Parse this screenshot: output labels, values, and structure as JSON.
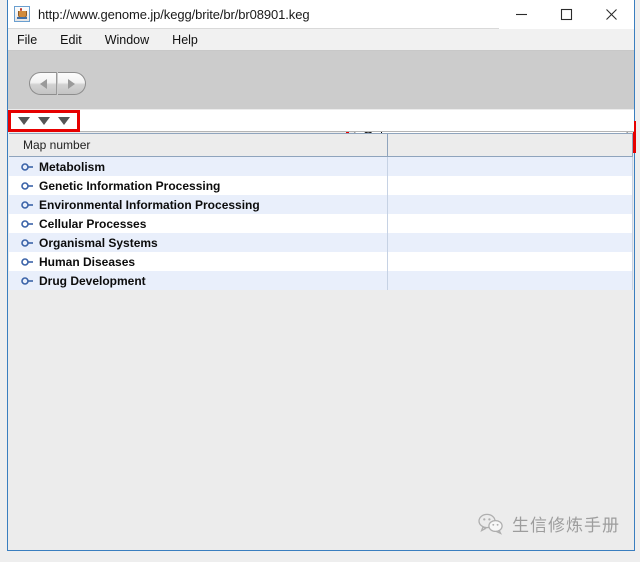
{
  "window": {
    "title": "http://www.genome.jp/kegg/brite/br/br08901.keg",
    "app_icon": "java-icon",
    "controls": {
      "minimize": "minimize-icon",
      "maximize": "maximize-icon",
      "close": "close-icon"
    }
  },
  "menubar": {
    "items": [
      {
        "label": "File"
      },
      {
        "label": "Edit"
      },
      {
        "label": "Window"
      },
      {
        "label": "Help"
      }
    ]
  },
  "toolbar": {
    "back_icon": "arrow-left-icon",
    "forward_icon": "arrow-right-icon"
  },
  "search": {
    "icon": "search-icon",
    "value": "",
    "placeholder": ""
  },
  "filter_bar": {
    "triangles": [
      {
        "icon": "triangle-down-icon"
      },
      {
        "icon": "triangle-down-icon"
      },
      {
        "icon": "triangle-down-icon"
      }
    ]
  },
  "table": {
    "columns": [
      {
        "label": "Map number"
      },
      {
        "label": ""
      }
    ],
    "rows": [
      {
        "label": "Metabolism",
        "handle": "tree-expand-icon",
        "value": ""
      },
      {
        "label": "Genetic Information Processing",
        "handle": "tree-expand-icon",
        "value": ""
      },
      {
        "label": "Environmental Information Processing",
        "handle": "tree-expand-icon",
        "value": ""
      },
      {
        "label": "Cellular Processes",
        "handle": "tree-expand-icon",
        "value": ""
      },
      {
        "label": "Organismal Systems",
        "handle": "tree-expand-icon",
        "value": ""
      },
      {
        "label": "Human Diseases",
        "handle": "tree-expand-icon",
        "value": ""
      },
      {
        "label": "Drug Development",
        "handle": "tree-expand-icon",
        "value": ""
      }
    ]
  },
  "watermark": {
    "icon": "wechat-icon",
    "text": "生信修炼手册"
  },
  "colors": {
    "annotation_red": "#e60000",
    "window_border_blue": "#3a7ebf",
    "row_stripe_blue": "#e9effb",
    "toolbar_gray": "#cccccc"
  }
}
